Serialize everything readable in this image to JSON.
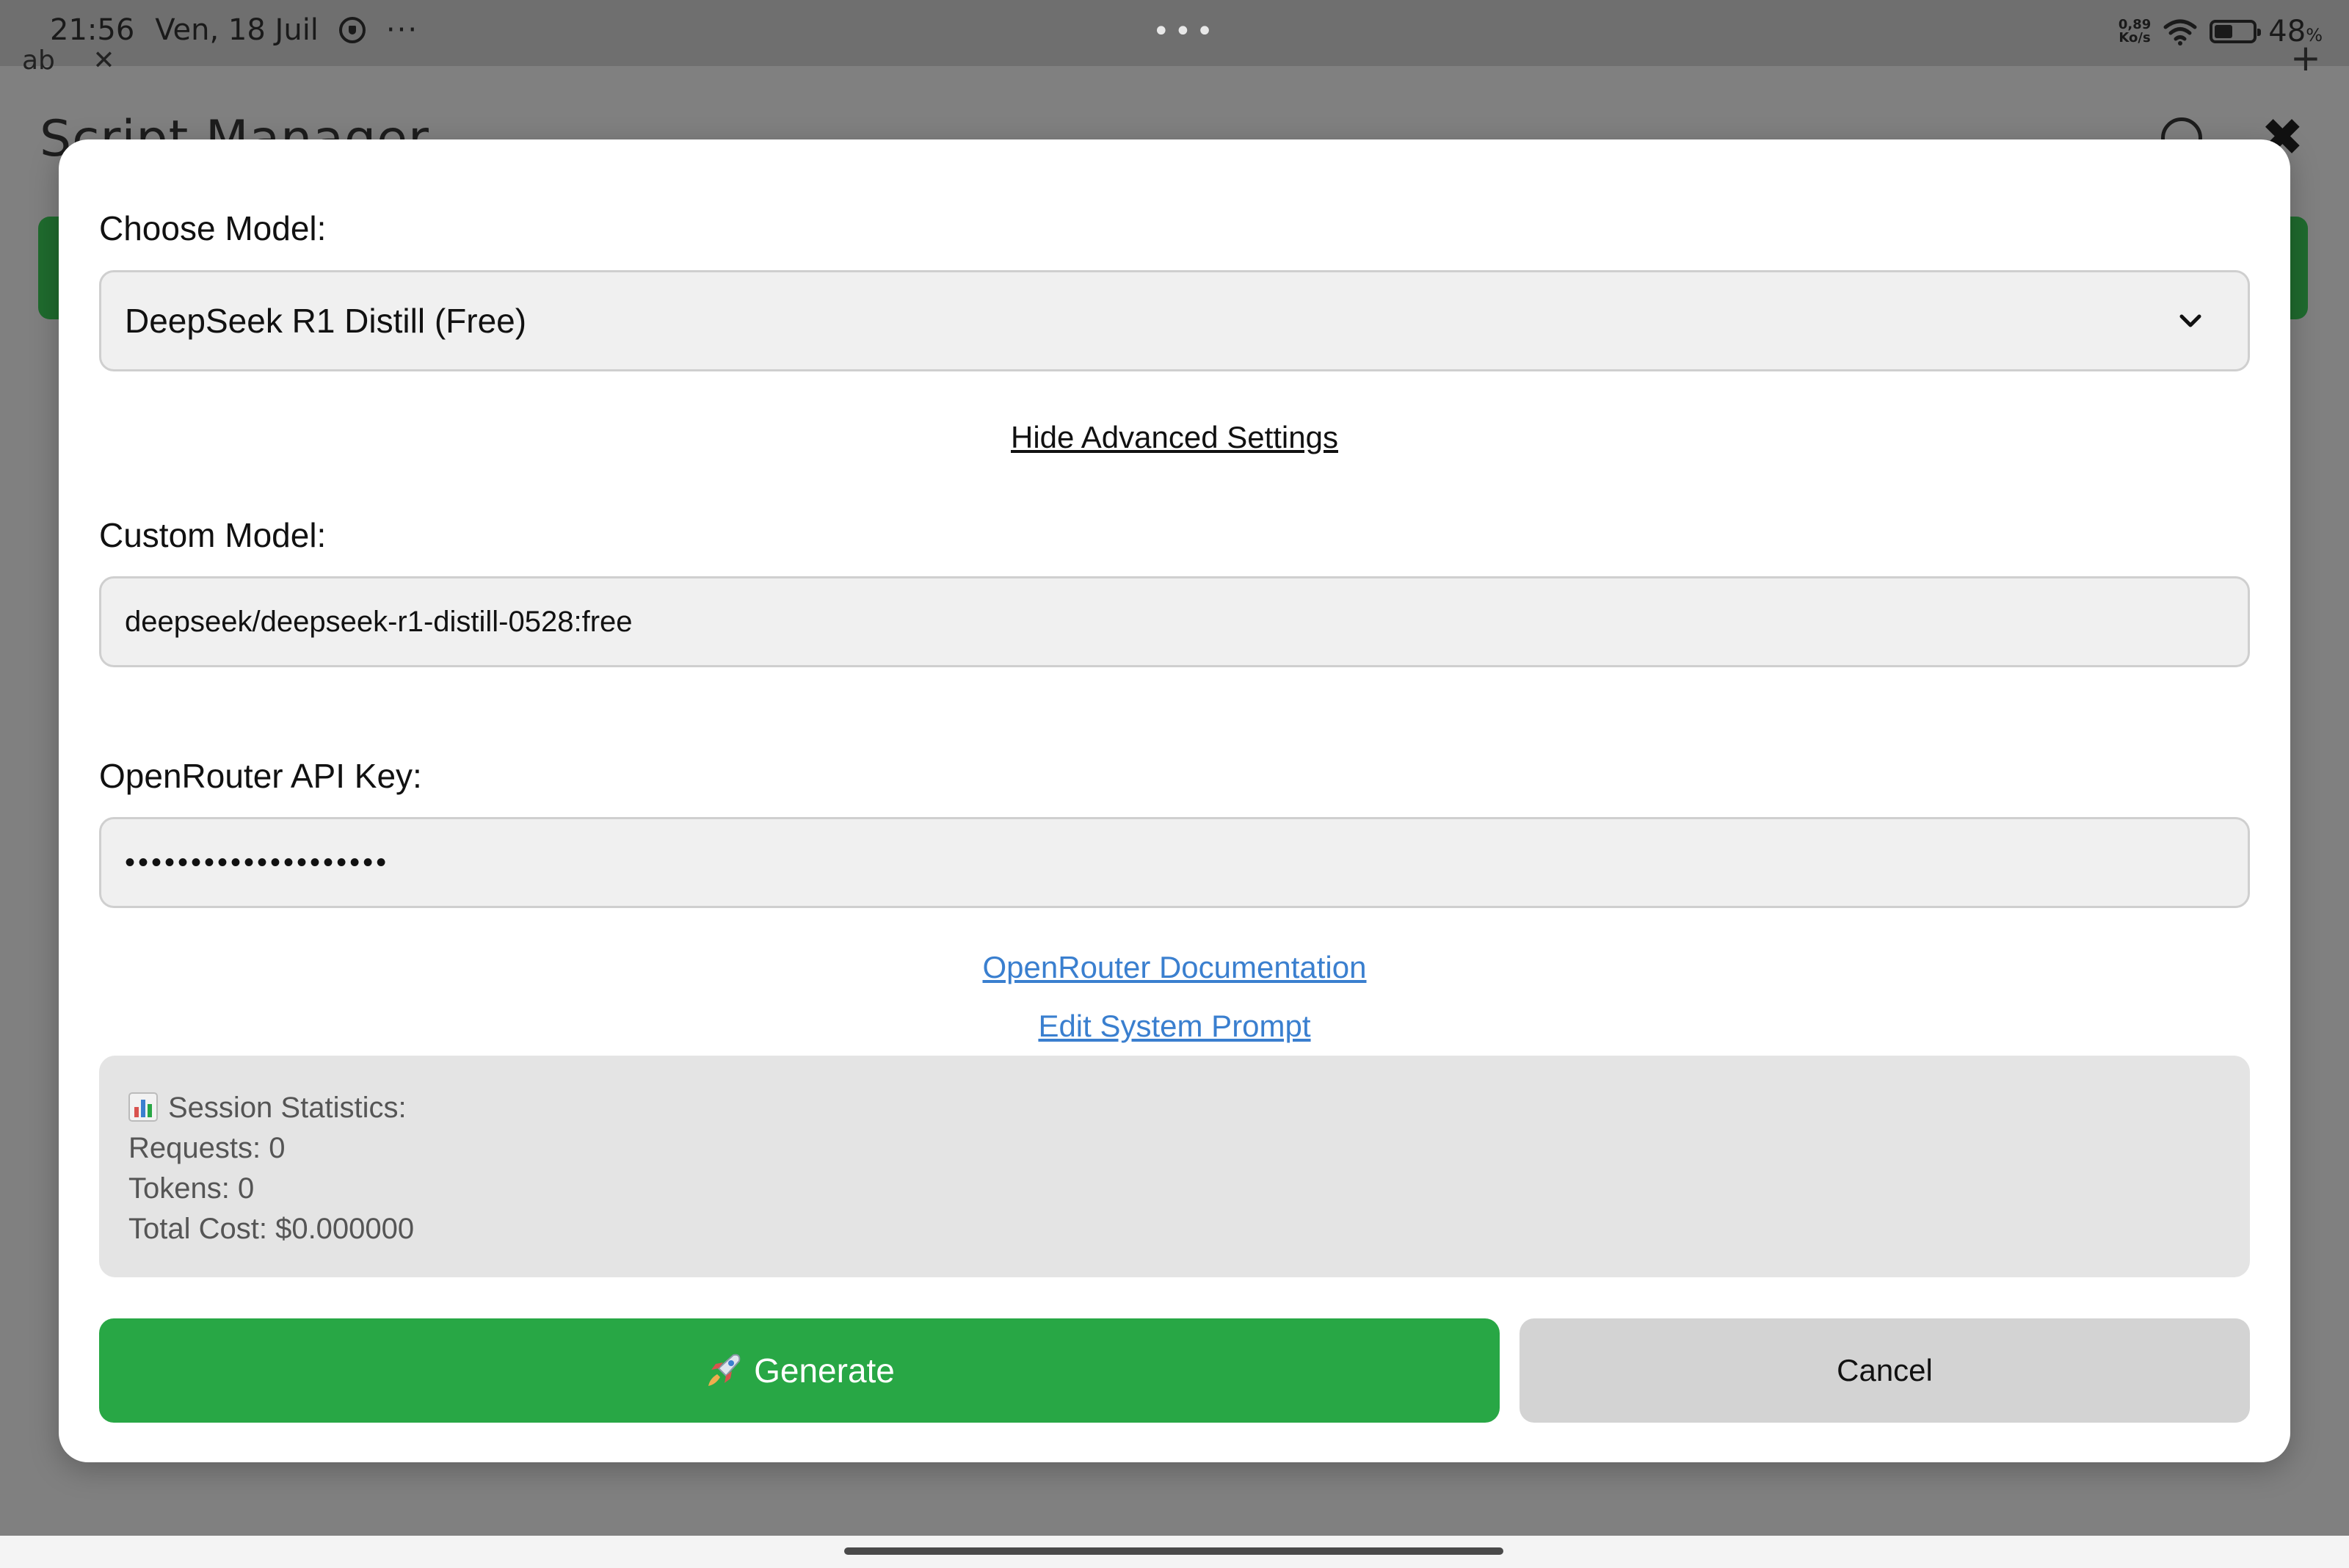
{
  "status_bar": {
    "time": "21:56",
    "date": "Ven, 18 Juil",
    "more": "···",
    "center_dots": "•••",
    "net_speed_value": "0,89",
    "net_speed_unit": "Ko/s",
    "battery_level": "48",
    "battery_unit": "%",
    "battery_fraction": 0.48
  },
  "background_app": {
    "title": "Script Manager",
    "tab_text": "ab",
    "tab_close": "✕",
    "close_glyph": "✖",
    "plus_glyph": "+"
  },
  "modal": {
    "model_label": "Choose Model:",
    "model_selected": "DeepSeek R1 Distill (Free)",
    "toggle_advanced": "Hide Advanced Settings",
    "custom_model_label": "Custom Model:",
    "custom_model_value": "deepseek/deepseek-r1-distill-0528:free",
    "api_key_label": "OpenRouter API Key:",
    "api_key_masked": "••••••••••••••••••••",
    "docs_link": "OpenRouter Documentation",
    "system_prompt_link": "Edit System Prompt",
    "stats": {
      "heading": "Session Statistics:",
      "requests": "Requests: 0",
      "tokens": "Tokens: 0",
      "total_cost": "Total Cost: $0.000000"
    },
    "generate_label": "Generate",
    "cancel_label": "Cancel"
  },
  "colors": {
    "primary_green": "#28a745",
    "link_blue": "#3a7fcf",
    "cancel_gray": "#d3d3d3"
  },
  "icons": [
    "shield-icon",
    "wifi-icon",
    "battery-icon",
    "chevron-down-icon",
    "bar-chart-icon",
    "rocket-icon",
    "info-icon",
    "close-icon"
  ]
}
